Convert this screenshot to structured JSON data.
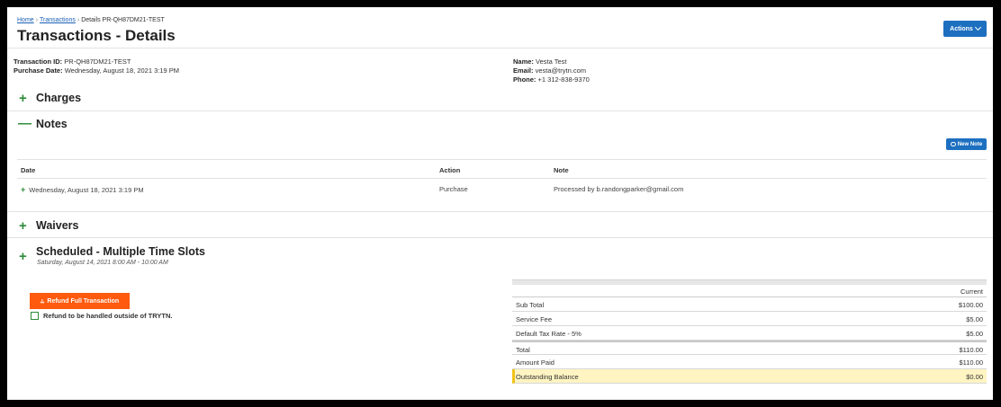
{
  "breadcrumb": {
    "home": "Home",
    "transactions": "Transactions",
    "current": "Details PR-QH87DM21-TEST"
  },
  "page": {
    "title": "Transactions - Details",
    "actions_label": "Actions"
  },
  "transaction": {
    "id_label": "Transaction ID:",
    "id_value": "PR-QH87DM21-TEST",
    "date_label": "Purchase Date:",
    "date_value": "Wednesday, August 18, 2021 3:19 PM"
  },
  "customer": {
    "name_label": "Name:",
    "name_value": "Vesta Test",
    "email_label": "Email:",
    "email_value": "vesta@trytn.com",
    "phone_label": "Phone:",
    "phone_value": "+1 312-838-9370"
  },
  "sections": {
    "charges": {
      "icon": "+",
      "title": "Charges"
    },
    "notes": {
      "icon": "—",
      "title": "Notes"
    },
    "waivers": {
      "icon": "+",
      "title": "Waivers"
    },
    "scheduled": {
      "icon": "+",
      "title": "Scheduled - Multiple Time Slots",
      "subtitle": "Saturday, August 14, 2021 8:00 AM - 10:00 AM"
    }
  },
  "notes": {
    "new_note_label": "New Note",
    "columns": [
      "Date",
      "Action",
      "Note"
    ],
    "rows": [
      {
        "expand": "+",
        "date": "Wednesday, August 18, 2021 3:19 PM",
        "action": "Purchase",
        "note": "Processed by b.randongparker@gmail.com"
      }
    ]
  },
  "refund": {
    "button_label": "Refund Full Transaction",
    "checkbox_label": "Refund to be handled outside of TRYTN.",
    "checked": false
  },
  "totals": {
    "column_header": "Current",
    "rows": [
      {
        "label": "Sub Total",
        "value": "$100.00"
      },
      {
        "label": "Service Fee",
        "value": "$5.00"
      },
      {
        "label": "Default Tax Rate - 5%",
        "value": "$5.00"
      },
      {
        "label": "Total",
        "value": "$110.00"
      },
      {
        "label": "Amount Paid",
        "value": "$110.00"
      },
      {
        "label": "Outstanding Balance",
        "value": "$0.00"
      }
    ]
  },
  "colors": {
    "primary": "#1d6fc0",
    "accent_green": "#2e8b3a",
    "refund_orange": "#ff5a0e",
    "highlight": "#fff4c2"
  },
  "icons": {
    "actions": "chevron-down-icon",
    "new_note": "speech-bubble-icon",
    "refund": "refund-icon"
  }
}
